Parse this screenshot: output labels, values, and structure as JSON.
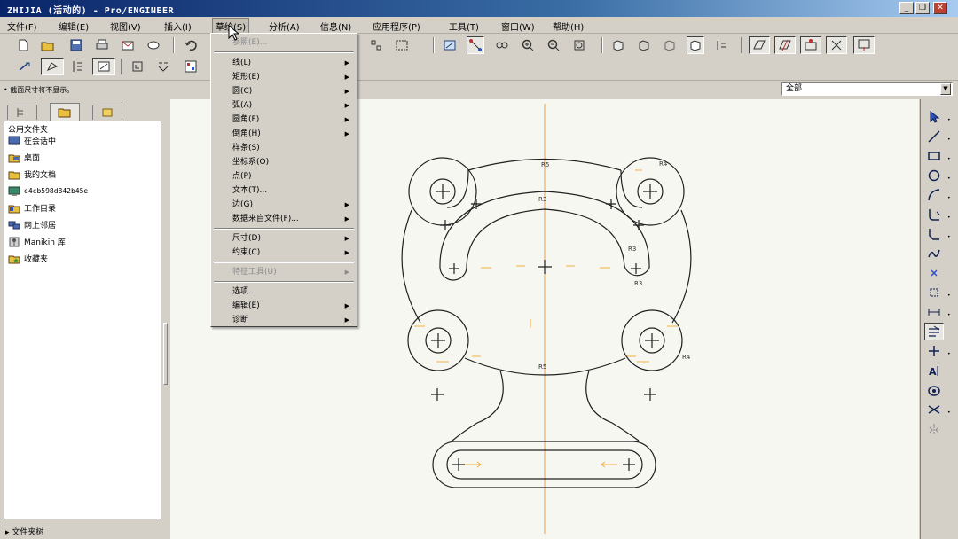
{
  "window": {
    "title": "ZHIJIA (活动的) - Pro/ENGINEER",
    "minimize": "_",
    "restore": "❐",
    "close": "✕"
  },
  "menubar": {
    "items": [
      "文件(F)",
      "编辑(E)",
      "视图(V)",
      "插入(I)",
      "草绘(S)",
      "分析(A)",
      "信息(N)",
      "应用程序(P)",
      "工具(T)",
      "窗口(W)",
      "帮助(H)"
    ],
    "active_index": 4
  },
  "status": {
    "message": "• 截面尺寸将不显示。"
  },
  "filter": {
    "value": "全部"
  },
  "sketch_menu": {
    "items": [
      {
        "label": "参照(E)...",
        "disabled": true,
        "submenu": false
      },
      {
        "label": "线(L)",
        "disabled": false,
        "submenu": true
      },
      {
        "label": "矩形(E)",
        "disabled": false,
        "submenu": true
      },
      {
        "label": "圆(C)",
        "disabled": false,
        "submenu": true
      },
      {
        "label": "弧(A)",
        "disabled": false,
        "submenu": true
      },
      {
        "label": "圆角(F)",
        "disabled": false,
        "submenu": true
      },
      {
        "label": "倒角(H)",
        "disabled": false,
        "submenu": true
      },
      {
        "label": "样条(S)",
        "disabled": false,
        "submenu": false
      },
      {
        "label": "坐标系(O)",
        "disabled": false,
        "submenu": false
      },
      {
        "label": "点(P)",
        "disabled": false,
        "submenu": false
      },
      {
        "label": "文本(T)...",
        "disabled": false,
        "submenu": false
      },
      {
        "label": "边(G)",
        "disabled": false,
        "submenu": true
      },
      {
        "label": "数据来自文件(F)...",
        "disabled": false,
        "submenu": true
      },
      {
        "label": "尺寸(D)",
        "disabled": false,
        "submenu": true
      },
      {
        "label": "约束(C)",
        "disabled": false,
        "submenu": true
      },
      {
        "label": "特征工具(U)",
        "disabled": true,
        "submenu": true
      },
      {
        "label": "选项...",
        "disabled": false,
        "submenu": false
      },
      {
        "label": "编辑(E)",
        "disabled": false,
        "submenu": true
      },
      {
        "label": "诊断",
        "disabled": false,
        "submenu": true
      }
    ]
  },
  "navigator": {
    "heading": "公用文件夹",
    "items": [
      {
        "label": "在会话中",
        "icon": "session-icon"
      },
      {
        "label": "桌面",
        "icon": "desktop-icon"
      },
      {
        "label": "我的文档",
        "icon": "documents-icon"
      },
      {
        "label": "e4cb598d842b45e",
        "icon": "computer-icon"
      },
      {
        "label": "工作目录",
        "icon": "working-dir-icon"
      },
      {
        "label": "网上邻居",
        "icon": "network-icon"
      },
      {
        "label": "Manikin 库",
        "icon": "manikin-icon"
      },
      {
        "label": "收藏夹",
        "icon": "favorites-icon"
      }
    ],
    "footer": "▸ 文件夹树"
  },
  "sketch": {
    "constraint_labels": [
      "R5",
      "R4",
      "R3",
      "R3",
      "R3",
      "R4",
      "R5"
    ]
  },
  "colors": {
    "centerline": "#f0a030",
    "geometry": "#202020",
    "canvas": "#f7f7f2",
    "weak_dim": "#f0b040"
  }
}
